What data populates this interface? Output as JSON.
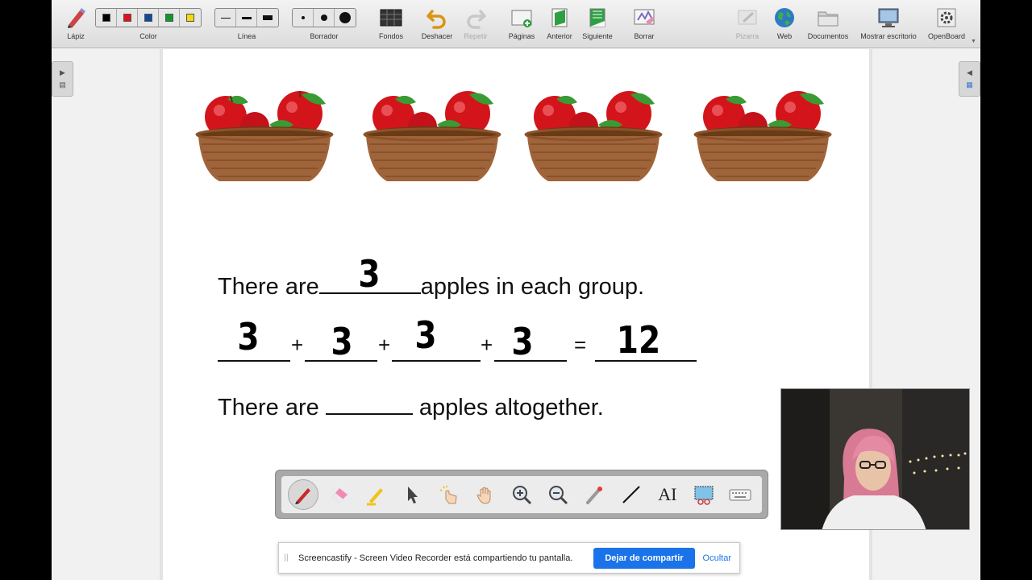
{
  "toolbar": {
    "pencil": "Lápiz",
    "color": "Color",
    "line": "Línea",
    "eraser": "Borrador",
    "backgrounds": "Fondos",
    "undo": "Deshacer",
    "redo": "Repetir",
    "pages": "Páginas",
    "previous": "Anterior",
    "next": "Siguiente",
    "clear": "Borrar",
    "board": "Pizarra",
    "web": "Web",
    "documents": "Documentos",
    "show_desktop": "Mostrar escritorio",
    "openboard": "OpenBoard"
  },
  "colors": [
    "#000000",
    "#e3101b",
    "#0d4b9e",
    "#0b9b2c",
    "#f5d80d"
  ],
  "worksheet": {
    "line1_start": "There are",
    "line1_end": "apples in each group.",
    "line1_answer": "3",
    "equation": {
      "addends": [
        "3",
        "3",
        "3",
        "3"
      ],
      "plus": "+",
      "equals": "=",
      "total": "12"
    },
    "line3_start": "There are",
    "line3_end": "apples altogether."
  },
  "basket_count": 4,
  "notice": {
    "message": "Screencastify - Screen Video Recorder está compartiendo tu pantalla.",
    "stop_button": "Dejar de compartir",
    "hide_button": "Ocultar"
  },
  "palette_tools": [
    "pen-icon",
    "eraser-icon",
    "highlighter-icon",
    "pointer-icon",
    "interact-icon",
    "hand-icon",
    "zoom-in-icon",
    "zoom-out-icon",
    "laser-pointer-icon",
    "line-icon",
    "text-icon",
    "capture-icon",
    "keyboard-icon"
  ],
  "palette_text_tool": "AI"
}
